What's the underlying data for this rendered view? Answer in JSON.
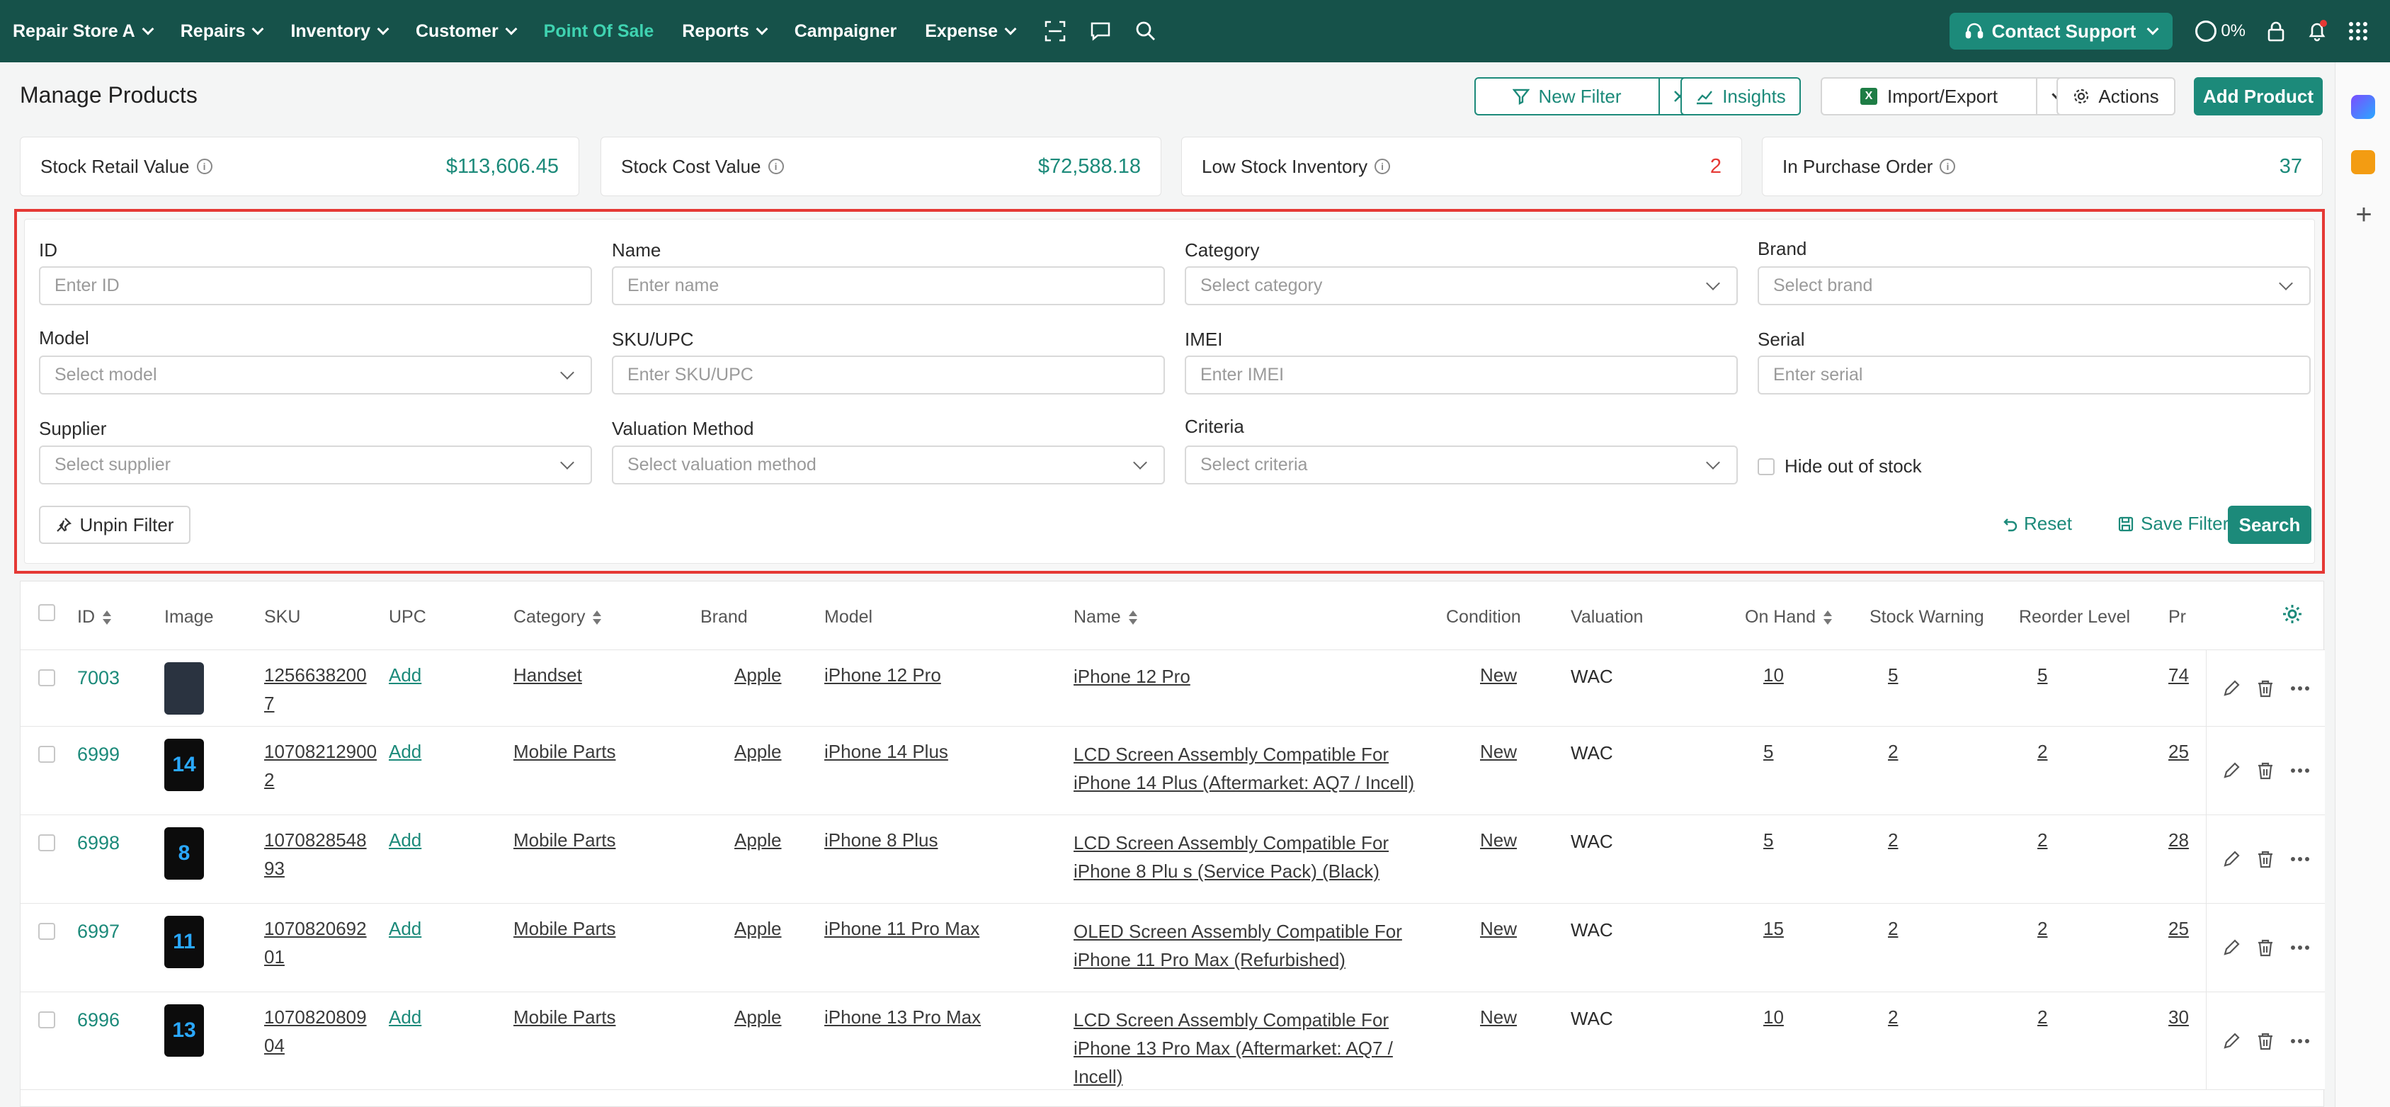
{
  "nav": {
    "store": "Repair Store A",
    "items": [
      "Repairs",
      "Inventory",
      "Customer",
      "Point Of Sale",
      "Reports",
      "Campaigner",
      "Expense"
    ],
    "support": "Contact Support",
    "progress": "0%"
  },
  "header": {
    "title": "Manage Products",
    "new_filter": "New Filter",
    "insights": "Insights",
    "import_export": "Import/Export",
    "actions": "Actions",
    "add_product": "Add Product"
  },
  "stats": [
    {
      "label": "Stock Retail Value",
      "value": "$113,606.45"
    },
    {
      "label": "Stock Cost Value",
      "value": "$72,588.18"
    },
    {
      "label": "Low Stock Inventory",
      "value": "2"
    },
    {
      "label": "In Purchase Order",
      "value": "37"
    }
  ],
  "filters": {
    "id": {
      "label": "ID",
      "placeholder": "Enter ID"
    },
    "name": {
      "label": "Name",
      "placeholder": "Enter name"
    },
    "category": {
      "label": "Category",
      "placeholder": "Select category"
    },
    "brand": {
      "label": "Brand",
      "placeholder": "Select brand"
    },
    "model": {
      "label": "Model",
      "placeholder": "Select model"
    },
    "sku": {
      "label": "SKU/UPC",
      "placeholder": "Enter SKU/UPC"
    },
    "imei": {
      "label": "IMEI",
      "placeholder": "Enter IMEI"
    },
    "serial": {
      "label": "Serial",
      "placeholder": "Enter serial"
    },
    "supplier": {
      "label": "Supplier",
      "placeholder": "Select supplier"
    },
    "valuation": {
      "label": "Valuation Method",
      "placeholder": "Select valuation method"
    },
    "criteria": {
      "label": "Criteria",
      "placeholder": "Select criteria"
    },
    "hide_out": "Hide out of stock",
    "unpin": "Unpin Filter",
    "reset": "Reset",
    "save": "Save Filter",
    "search": "Search"
  },
  "table": {
    "headers": [
      "ID",
      "Image",
      "SKU",
      "UPC",
      "Category",
      "Brand",
      "Model",
      "Name",
      "Condition",
      "Valuation",
      "On Hand",
      "Stock Warning",
      "Reorder Level",
      "Pr"
    ],
    "rows": [
      {
        "id": "7003",
        "sku1": "1256638200",
        "sku2": "7",
        "upc": "Add",
        "category": "Handset",
        "brand": "Apple",
        "model": "iPhone 12 Pro",
        "name1": "iPhone 12 Pro",
        "name2": "",
        "name3": "",
        "condition": "New",
        "valuation": "WAC",
        "on_hand": "10",
        "warning": "5",
        "reorder": "5",
        "price": "74"
      },
      {
        "id": "6999",
        "sku1": "10708212900",
        "sku2": "2",
        "upc": "Add",
        "category": "Mobile Parts",
        "brand": "Apple",
        "model": "iPhone 14 Plus",
        "name1": "LCD Screen Assembly Compatible For",
        "name2": "iPhone 14 Plus (Aftermarket: AQ7 / Incell)",
        "name3": "",
        "condition": "New",
        "valuation": "WAC",
        "on_hand": "5",
        "warning": "2",
        "reorder": "2",
        "price": "25"
      },
      {
        "id": "6998",
        "sku1": "1070828548",
        "sku2": "93",
        "upc": "Add",
        "category": "Mobile Parts",
        "brand": "Apple",
        "model": "iPhone 8 Plus",
        "name1": "LCD Screen Assembly Compatible For",
        "name2": "iPhone 8 Plu s (Service Pack) (Black)",
        "name3": "",
        "condition": "New",
        "valuation": "WAC",
        "on_hand": "5",
        "warning": "2",
        "reorder": "2",
        "price": "28"
      },
      {
        "id": "6997",
        "sku1": "1070820692",
        "sku2": "01",
        "upc": "Add",
        "category": "Mobile Parts",
        "brand": "Apple",
        "model": "iPhone 11 Pro Max",
        "name1": "OLED Screen Assembly Compatible For",
        "name2": "iPhone 11 Pro Max (Refurbished)",
        "name3": "",
        "condition": "New",
        "valuation": "WAC",
        "on_hand": "15",
        "warning": "2",
        "reorder": "2",
        "price": "25"
      },
      {
        "id": "6996",
        "sku1": "1070820809",
        "sku2": "04",
        "upc": "Add",
        "category": "Mobile Parts",
        "brand": "Apple",
        "model": "iPhone 13 Pro Max",
        "name1": "LCD Screen Assembly Compatible For",
        "name2": "iPhone 13 Pro Max (Aftermarket: AQ7 /",
        "name3": "Incell)",
        "condition": "New",
        "valuation": "WAC",
        "on_hand": "10",
        "warning": "2",
        "reorder": "2",
        "price": "30"
      }
    ],
    "thumb_labels": [
      "",
      "14",
      "8",
      "11",
      "13"
    ]
  },
  "colors": {
    "nav": "#16524a",
    "accent": "#1c8a7a",
    "active_nav": "#3fd3b1",
    "danger": "#e53935"
  },
  "icons": [
    "chevron-down-icon",
    "scan-icon",
    "chat-icon",
    "search-icon",
    "headset-icon",
    "lock-icon",
    "bell-icon",
    "grid-icon",
    "filter-icon",
    "close-icon",
    "chart-icon",
    "excel-icon",
    "gear-icon",
    "info-icon",
    "pin-icon",
    "reset-icon",
    "save-icon",
    "edit-icon",
    "trash-icon",
    "more-icon"
  ]
}
